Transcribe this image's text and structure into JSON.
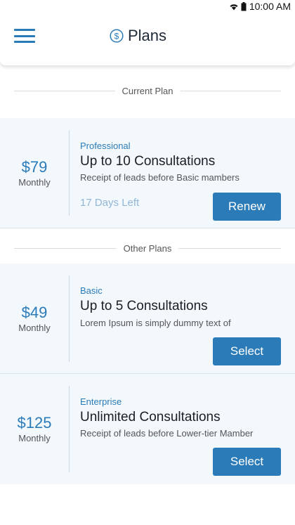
{
  "status_bar": {
    "time": "10:00 AM"
  },
  "header": {
    "title": "Plans"
  },
  "sections": {
    "current": "Current Plan",
    "other": "Other Plans"
  },
  "current_plan": {
    "price": "$79",
    "period": "Monthly",
    "tier": "Professional",
    "name": "Up to 10 Consultations",
    "description": "Receipt of leads before Basic mambers",
    "days_left": "17 Days Left",
    "button": "Renew"
  },
  "other_plans": [
    {
      "price": "$49",
      "period": "Monthly",
      "tier": "Basic",
      "name": "Up to 5 Consultations",
      "description": "Lorem Ipsum is simply dummy text of",
      "button": "Select"
    },
    {
      "price": "$125",
      "period": "Monthly",
      "tier": "Enterprise",
      "name": "Unlimited Consultations",
      "description": "Receipt of leads before Lower-tier Mamber",
      "button": "Select"
    }
  ],
  "colors": {
    "accent": "#2a7bb8",
    "card_bg": "#f3f8fd",
    "muted_accent": "#92b6d6"
  },
  "icons": [
    "wifi-icon",
    "battery-icon",
    "menu-icon",
    "dollar-icon"
  ]
}
